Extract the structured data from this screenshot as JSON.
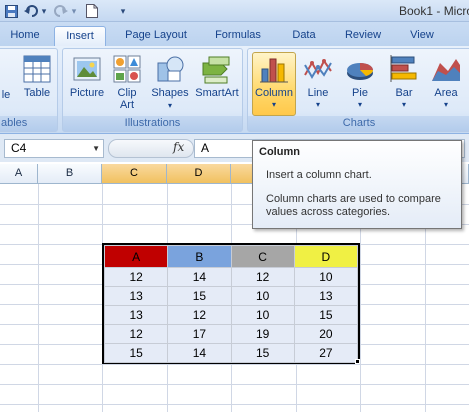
{
  "window": {
    "title": "Book1 - Micro"
  },
  "quick_access": {
    "undo_arrow": "▾",
    "redo_arrow": "▾",
    "customize": "▾"
  },
  "tabs": [
    {
      "label": "Home"
    },
    {
      "label": "Insert"
    },
    {
      "label": "Page Layout"
    },
    {
      "label": "Formulas"
    },
    {
      "label": "Data"
    },
    {
      "label": "Review"
    },
    {
      "label": "View"
    }
  ],
  "ribbon": {
    "tables_group": {
      "label": "ables",
      "partial_button_label": "le",
      "table_label": "Table"
    },
    "illustrations_group": {
      "label": "Illustrations",
      "picture_label": "Picture",
      "clipart_label_1": "Clip",
      "clipart_label_2": "Art",
      "shapes_label": "Shapes",
      "smartart_label": "SmartArt"
    },
    "charts_group": {
      "label": "Charts",
      "column_label": "Column",
      "line_label": "Line",
      "pie_label": "Pie",
      "bar_label": "Bar",
      "area_label": "Area"
    },
    "dropdown_glyph": "▾"
  },
  "formula_bar": {
    "name_box": "C4",
    "fx": "fx",
    "value": "A"
  },
  "columns": [
    "A",
    "B",
    "C",
    "D",
    "E"
  ],
  "tooltip": {
    "title": "Column",
    "line1": "Insert a column chart.",
    "line2": "Column charts are used to compare values across categories."
  },
  "data_table": {
    "headers": [
      "A",
      "B",
      "C",
      "D"
    ],
    "header_colors": [
      "#c00000",
      "#7aa3dd",
      "#a6a6a6",
      "#f0f044"
    ],
    "rows": [
      [
        "12",
        "14",
        "12",
        "10"
      ],
      [
        "13",
        "15",
        "10",
        "13"
      ],
      [
        "13",
        "12",
        "10",
        "15"
      ],
      [
        "12",
        "17",
        "19",
        "20"
      ],
      [
        "15",
        "14",
        "15",
        "27"
      ]
    ]
  }
}
